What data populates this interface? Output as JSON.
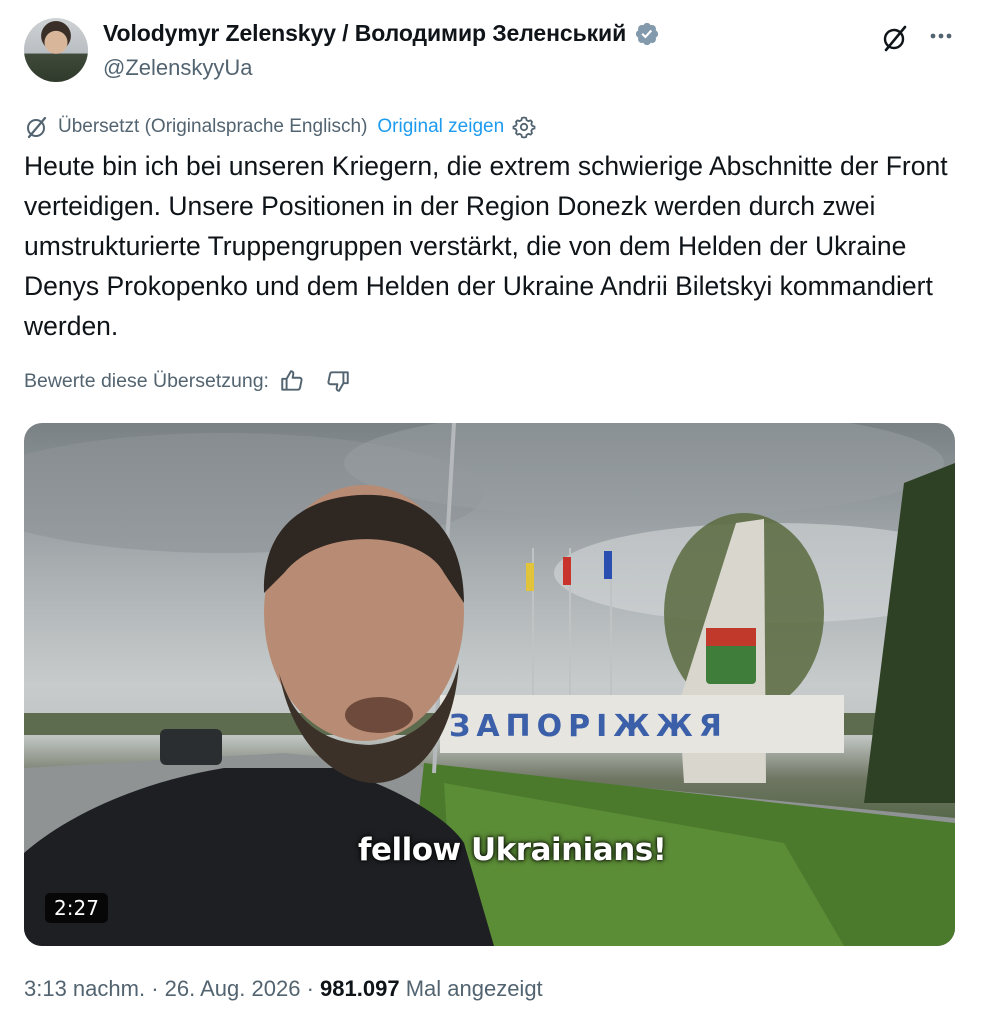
{
  "author": {
    "name": "Volodymyr Zelenskyy / Володимир Зеленський",
    "handle": "@ZelenskyyUa"
  },
  "translation": {
    "note": "Übersetzt (Originalsprache Englisch)",
    "show_original": "Original zeigen"
  },
  "tweet": {
    "text": "Heute bin ich bei unseren Kriegern, die extrem schwierige Abschnitte der Front verteidigen. Unsere Positionen in der Region Donezk werden durch zwei umstrukturierte Truppengruppen verstärkt, die von dem Helden der Ukraine Denys Prokopenko und dem Helden der Ukraine Andrii Biletskyi kommandiert werden."
  },
  "rating": {
    "label": "Bewerte diese Übersetzung:"
  },
  "video": {
    "caption": "fellow Ukrainians!",
    "duration": "2:27",
    "sign_text": "ЗАПОРІЖЖЯ"
  },
  "meta": {
    "time": "3:13 nachm.",
    "separator": "·",
    "date": "26. Aug. 2026",
    "views_count": "981.097",
    "views_label": "Mal angezeigt"
  },
  "icons": {
    "verified": "verified-badge-icon",
    "grok": "grok-icon",
    "more": "more-icon",
    "translate": "translate-icon",
    "settings": "gear-icon",
    "thumbs_up": "thumbs-up-icon",
    "thumbs_down": "thumbs-down-icon"
  },
  "colors": {
    "text": "#0f1419",
    "secondary": "#536471",
    "link": "#1d9bf0",
    "verified": "#829aab"
  }
}
